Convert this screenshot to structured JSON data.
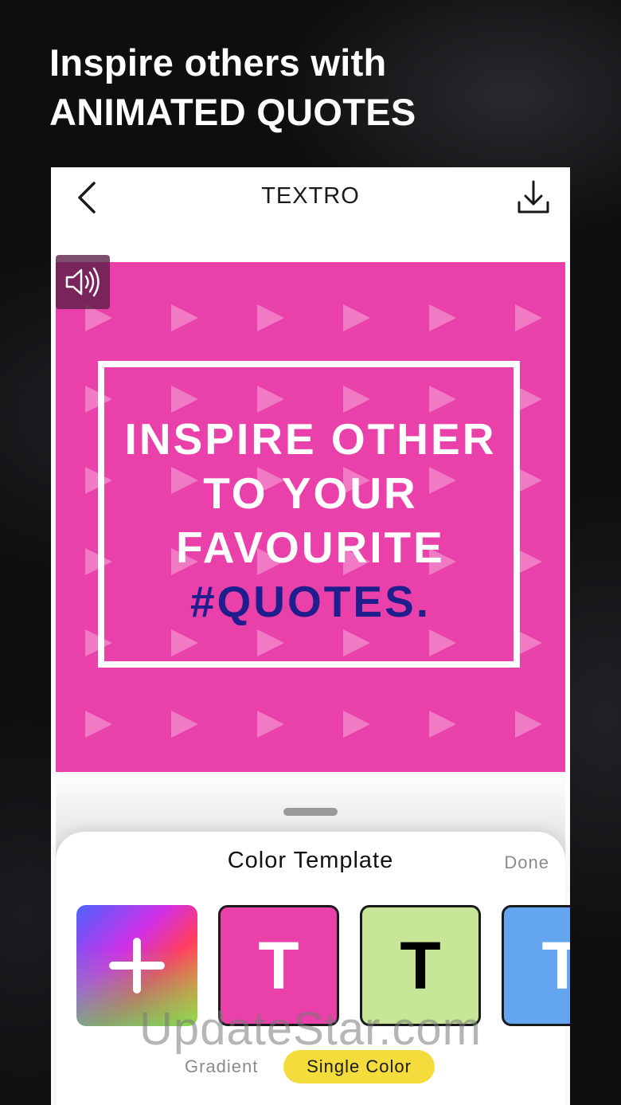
{
  "promo": {
    "line1": "Inspire others with",
    "line2": "ANIMATED QUOTES"
  },
  "header": {
    "title": "TEXTRO",
    "back_icon": "chevron-left-icon",
    "download_icon": "download-icon"
  },
  "canvas": {
    "quote_lines": [
      "INSPIRE OTHER",
      "TO YOUR",
      "FAVOURITE"
    ],
    "quote_accent": "#QUOTES.",
    "sound_icon": "speaker-icon",
    "colors": {
      "background": "#e940a9",
      "accent_text": "#1e1e8c",
      "pattern": "#f28dcd"
    }
  },
  "panel": {
    "title": "Color Template",
    "done_label": "Done",
    "templates": [
      {
        "type": "gradient",
        "label": "+"
      },
      {
        "type": "single",
        "letter": "T",
        "bg": "#e940a9",
        "text_color": "#ffffff"
      },
      {
        "type": "single",
        "letter": "T",
        "bg": "#c7e698",
        "text_color": "#000000"
      },
      {
        "type": "single",
        "letter": "T",
        "bg": "#64a5ef",
        "text_color": "#ffffff"
      }
    ],
    "tabs": [
      {
        "label": "Gradient",
        "active": false
      },
      {
        "label": "Single Color",
        "active": true
      }
    ],
    "watermark": "UpdateStar.com"
  }
}
